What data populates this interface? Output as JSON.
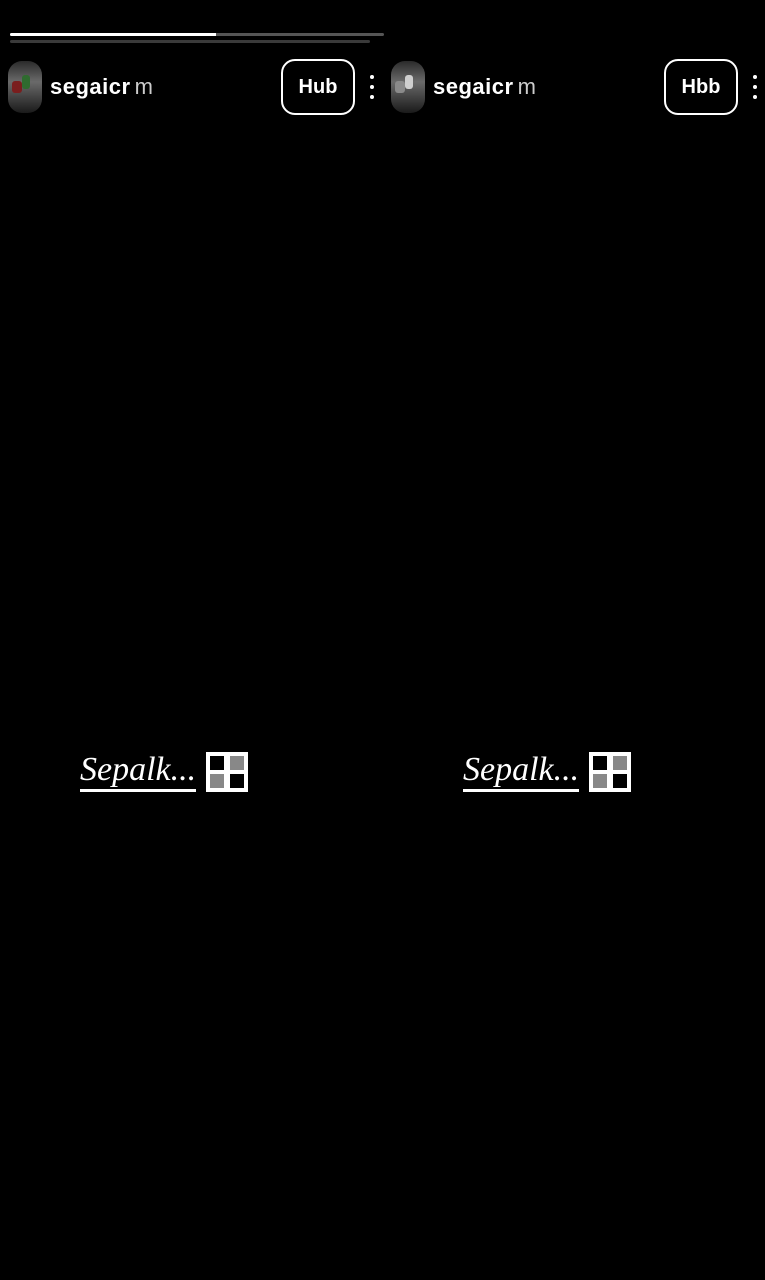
{
  "progress": [
    {
      "fraction": 0.55
    },
    {
      "fraction": 0.0
    }
  ],
  "panes": [
    {
      "username": "segaicr",
      "username_suffix": "m",
      "follow_label": "Hub",
      "caption": "Sepalk...",
      "avatar_icon": "profile-photo"
    },
    {
      "username": "segaicr",
      "username_suffix": "m",
      "follow_label": "Hbb",
      "caption": "Sepalk...",
      "avatar_icon": "profile-photo"
    }
  ],
  "icons": {
    "more": "more-vertical-icon",
    "expand": "expand-arrow-icon"
  },
  "colors": {
    "background": "#000000",
    "foreground": "#ffffff",
    "track": "#555555"
  }
}
